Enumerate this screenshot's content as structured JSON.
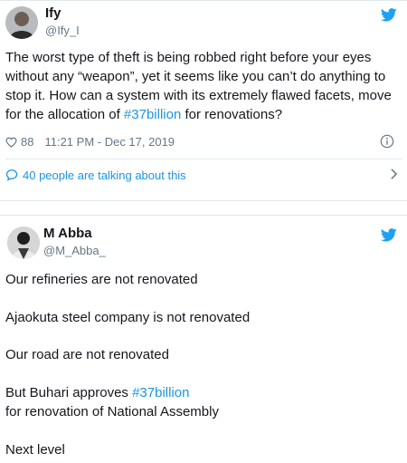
{
  "tweet1": {
    "name": "Ify",
    "handle": "@Ify_I",
    "text_before": "The worst type of theft is being robbed right before your eyes without any “weapon”, yet it seems like you can’t do anything to stop it. How can a system with its extremely flawed facets, move for the allocation of ",
    "hashtag": "#37billion",
    "text_after": " for renovations?",
    "likes": "88",
    "timestamp": "11:21 PM - Dec 17, 2019",
    "talking": "40 people are talking about this"
  },
  "tweet2": {
    "name": "M Abba",
    "handle": "@M_Abba_",
    "line1": "Our refineries are not renovated",
    "line2": "Ajaokuta steel company is not renovated",
    "line3": "Our road are not renovated",
    "line4_before": "But Buhari approves ",
    "line4_hashtag": "#37billion",
    "line5": "for renovation of National Assembly",
    "line6": "Next level"
  },
  "colors": {
    "twitter_blue": "#1da1f2",
    "link_blue": "#1b95e0",
    "secondary_text": "#657786",
    "border": "#e1e8ed"
  },
  "icons": [
    "twitter-bird-icon",
    "heart-icon",
    "info-icon",
    "comment-bubble-icon",
    "chevron-right-icon"
  ]
}
